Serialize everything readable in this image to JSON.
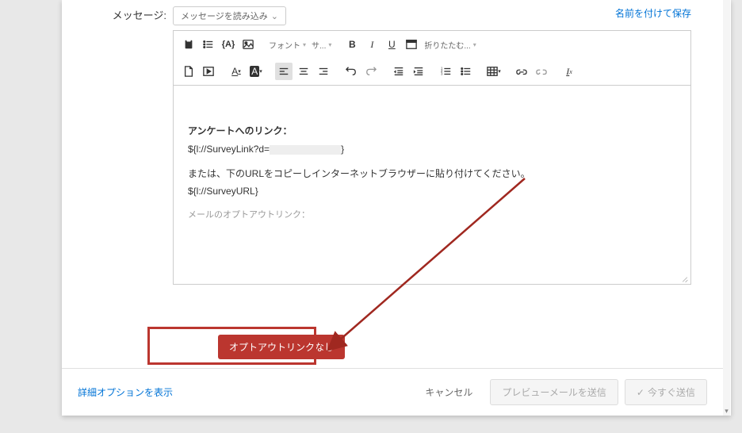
{
  "label": "メッセージ:",
  "loadMessage": "メッセージを読み込み",
  "saveAs": "名前を付けて保存",
  "toolbar": {
    "font": "フォント",
    "size": "サ...",
    "fold": "折りたたむ..."
  },
  "body": {
    "linkLabel": "アンケートへのリンク：",
    "surveyLinkPre": "${l://SurveyLink?d=",
    "surveyLinkPost": "}",
    "instruction": "または、下のURLをコピーしインターネットブラウザーに貼り付けてください。",
    "surveyUrl": "${l://SurveyURL}",
    "optoutLabel": "メールのオプトアウトリンク："
  },
  "optoutBtn": "オプトアウトリンクなし",
  "footer": {
    "advanced": "詳細オプションを表示",
    "cancel": "キャンセル",
    "preview": "プレビューメールを送信",
    "send": "今すぐ送信"
  }
}
